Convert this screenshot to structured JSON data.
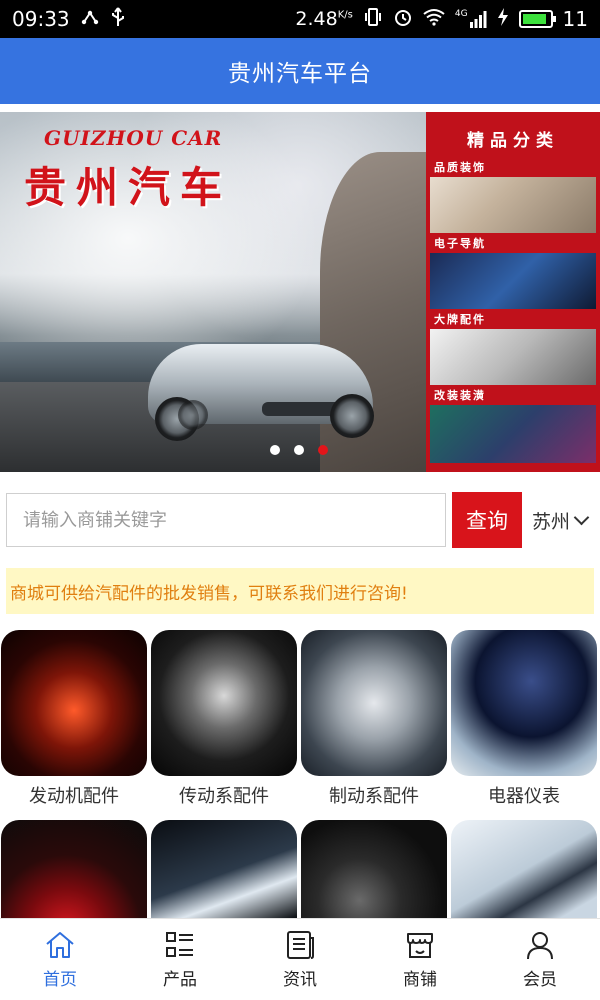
{
  "status_bar": {
    "time": "09:33",
    "speed": "2.48",
    "speed_unit": "K/s",
    "network": "4G",
    "battery_level": 0.9,
    "battery_number": "11",
    "battery_color": "#3de13d"
  },
  "app_bar": {
    "title": "贵州汽车平台",
    "color": "#3673e0"
  },
  "banner": {
    "title_en": "GUIZHOU CAR",
    "title_zh": "贵州汽车",
    "side_title": "精品分类",
    "side_sections": [
      {
        "label": "品质装饰",
        "image": "car-interior-image"
      },
      {
        "label": "电子导航",
        "image": "navigation-image"
      },
      {
        "label": "大牌配件",
        "image": "car-parts-image"
      },
      {
        "label": "改装装潢",
        "image": "wrapped-car-image"
      }
    ],
    "dots_total": 3,
    "active_dot": 3
  },
  "search": {
    "placeholder": "请输入商铺关键字",
    "value": "",
    "button_label": "查询",
    "city": "苏州",
    "accent": "#d8141b"
  },
  "notice": {
    "text": "商城可供给汽配件的批发销售，可联系我们进行咨询!"
  },
  "categories": [
    {
      "label": "发动机配件",
      "image": "engine-image"
    },
    {
      "label": "传动系配件",
      "image": "steering-wheel-image"
    },
    {
      "label": "制动系配件",
      "image": "brake-disc-image"
    },
    {
      "label": "电器仪表",
      "image": "dashboard-image"
    },
    {
      "label": "",
      "image": "cherries-image"
    },
    {
      "label": "",
      "image": "headlight-image"
    },
    {
      "label": "",
      "image": "interior-detail-image"
    },
    {
      "label": "",
      "image": "wiper-image"
    }
  ],
  "bottom_nav": [
    {
      "label": "首页",
      "icon": "home-icon",
      "active": true
    },
    {
      "label": "产品",
      "icon": "product-list-icon",
      "active": false
    },
    {
      "label": "资讯",
      "icon": "news-icon",
      "active": false
    },
    {
      "label": "商铺",
      "icon": "shop-icon",
      "active": false
    },
    {
      "label": "会员",
      "icon": "member-icon",
      "active": false
    }
  ],
  "nav_active_color": "#2f6fde"
}
